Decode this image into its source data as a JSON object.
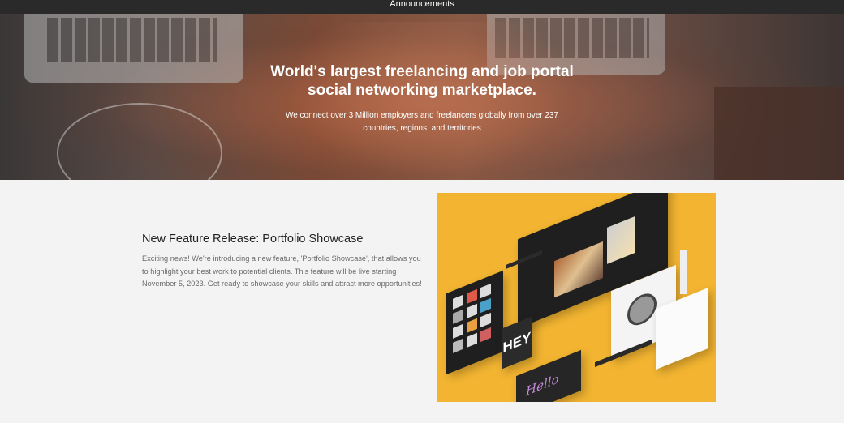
{
  "nav": {
    "announcements": "Announcements"
  },
  "hero": {
    "title_line1": "World's largest freelancing and job portal",
    "title_line2": "social networking marketplace.",
    "subtitle_line1": "We connect over 3 Million employers and freelancers globally from over 237",
    "subtitle_line2": "countries, regions, and territories"
  },
  "feature": {
    "title": "New Feature Release: Portfolio Showcase",
    "body": "Exciting news! We're introducing a new feature, 'Portfolio Showcase', that allows you to highlight your best work to potential clients. This feature will be live starting November 5, 2023. Get ready to showcase your skills and attract more opportunities!",
    "image_text_hey": "HEY",
    "image_text_hello": "Hello",
    "accent_color": "#f2b431"
  }
}
